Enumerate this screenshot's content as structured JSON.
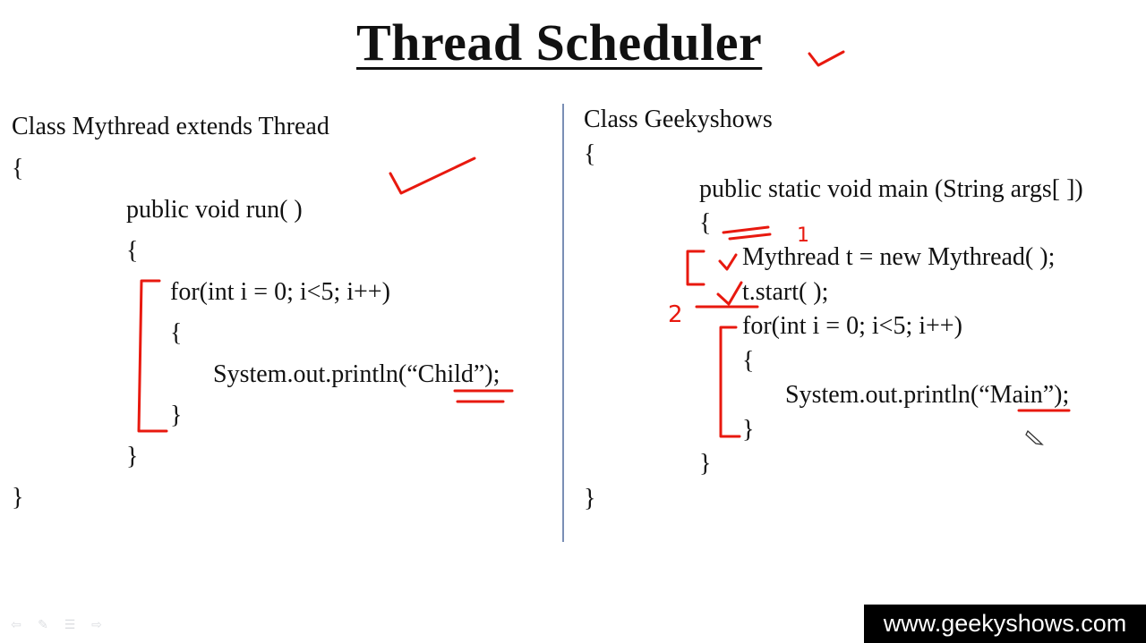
{
  "slide": {
    "title": "Thread Scheduler"
  },
  "left_code": {
    "line1": "Class Mythread extends Thread",
    "line2": "{",
    "line3": "public void run( )",
    "line4": "{",
    "line5": "for(int i = 0; i<5; i++)",
    "line6": "{",
    "line7": "System.out.println(“Child”);",
    "line8": "}",
    "line9": "}",
    "line10": "}"
  },
  "right_code": {
    "line1": "Class Geekyshows",
    "line2": "{",
    "line3": "public static void main (String args[ ])",
    "line4": "{",
    "line5": "Mythread t = new Mythread( );",
    "line6": "t.start( );",
    "line7": "for(int i = 0; i<5; i++)",
    "line8": "{",
    "line9": "System.out.println(“Main”);",
    "line10": "}",
    "line11": "}",
    "line12": "}"
  },
  "annotations": {
    "number_one": "1",
    "number_two": "2",
    "ink_color": "#e8190f"
  },
  "footer": {
    "watermark": "www.geekyshows.com"
  },
  "nav_icons": [
    "back-arrow-icon",
    "pen-icon",
    "menu-icon",
    "forward-arrow-icon"
  ],
  "colors": {
    "background": "#ffffff",
    "text": "#111111",
    "divider": "#7a8fb5",
    "annotation_ink": "#e8190f",
    "watermark_bg": "#000000",
    "watermark_text": "#ffffff"
  }
}
